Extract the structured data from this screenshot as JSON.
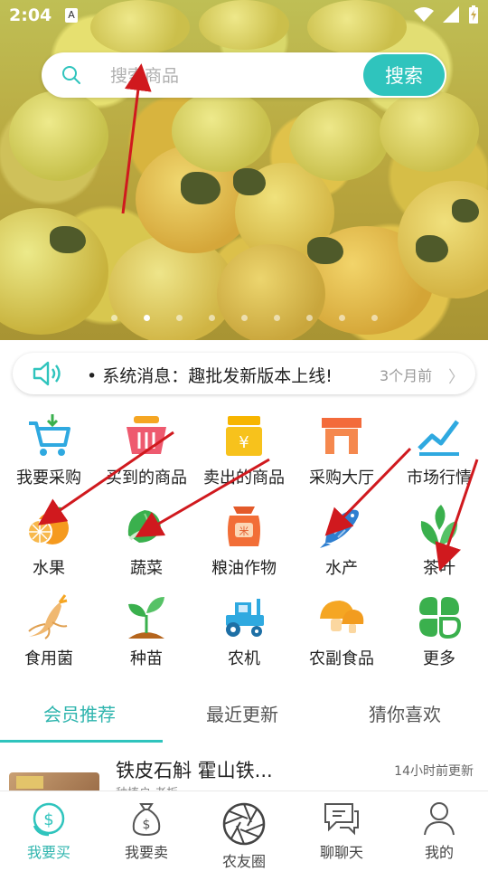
{
  "status_bar": {
    "time": "2:04",
    "input_badge": "A"
  },
  "search": {
    "placeholder": "搜索商品",
    "button_label": "搜索"
  },
  "banner": {
    "page_count": 9,
    "active_index": 1
  },
  "notice": {
    "text": "系统消息：趣批发新版本上线!",
    "time": "3个月前"
  },
  "categories": [
    {
      "label": "我要采购",
      "icon": "shopping-cart-icon"
    },
    {
      "label": "买到的商品",
      "icon": "basket-icon"
    },
    {
      "label": "卖出的商品",
      "icon": "money-box-icon"
    },
    {
      "label": "采购大厅",
      "icon": "storefront-icon"
    },
    {
      "label": "市场行情",
      "icon": "trend-chart-icon"
    },
    {
      "label": "水果",
      "icon": "orange-icon"
    },
    {
      "label": "蔬菜",
      "icon": "cabbage-icon"
    },
    {
      "label": "粮油作物",
      "icon": "grain-sack-icon"
    },
    {
      "label": "水产",
      "icon": "fish-icon"
    },
    {
      "label": "茶叶",
      "icon": "tea-leaf-icon"
    },
    {
      "label": "食用菌",
      "icon": "ginseng-icon"
    },
    {
      "label": "种苗",
      "icon": "seedling-icon"
    },
    {
      "label": "农机",
      "icon": "tractor-icon"
    },
    {
      "label": "农副食品",
      "icon": "mushroom-icon"
    },
    {
      "label": "更多",
      "icon": "clover-more-icon"
    }
  ],
  "tabs": [
    {
      "label": "会员推荐",
      "active": true
    },
    {
      "label": "最近更新",
      "active": false
    },
    {
      "label": "猜你喜欢",
      "active": false
    }
  ],
  "listing": {
    "title": "铁皮石斛 霍山铁...",
    "updated": "14小时前更新",
    "seller": "种植户 老板"
  },
  "bottom_nav": [
    {
      "label": "我要买",
      "icon": "dollar-coin-icon",
      "active": true
    },
    {
      "label": "我要卖",
      "icon": "money-bag-icon",
      "active": false
    },
    {
      "label": "农友圈",
      "icon": "aperture-icon",
      "active": false
    },
    {
      "label": "聊聊天",
      "icon": "chat-icon",
      "active": false
    },
    {
      "label": "我的",
      "icon": "user-icon",
      "active": false
    }
  ],
  "colors": {
    "accent": "#2fc4bd",
    "annotation": "#d0191e"
  }
}
